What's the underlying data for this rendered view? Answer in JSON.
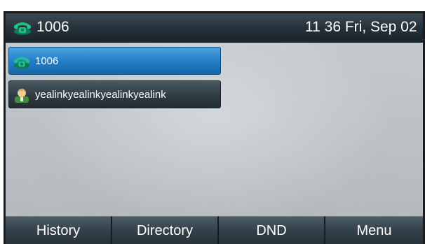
{
  "status_bar": {
    "account": "1006",
    "time": "11 36 Fri, Sep 02",
    "icon": "phone-handset-icon"
  },
  "line_keys": [
    {
      "label": "1006",
      "icon": "phone-handset-icon",
      "selected": true
    },
    {
      "label": "yealinkyealinkyealinkyealink",
      "icon": "contact-person-icon",
      "selected": false
    }
  ],
  "softkeys": [
    {
      "label": "History"
    },
    {
      "label": "Directory"
    },
    {
      "label": "DND"
    },
    {
      "label": "Menu"
    }
  ],
  "colors": {
    "selected_key": "#2480c8",
    "key_dark": "#2f3b43",
    "status_bar": "#25313a",
    "phone_icon": "#18b07a"
  }
}
